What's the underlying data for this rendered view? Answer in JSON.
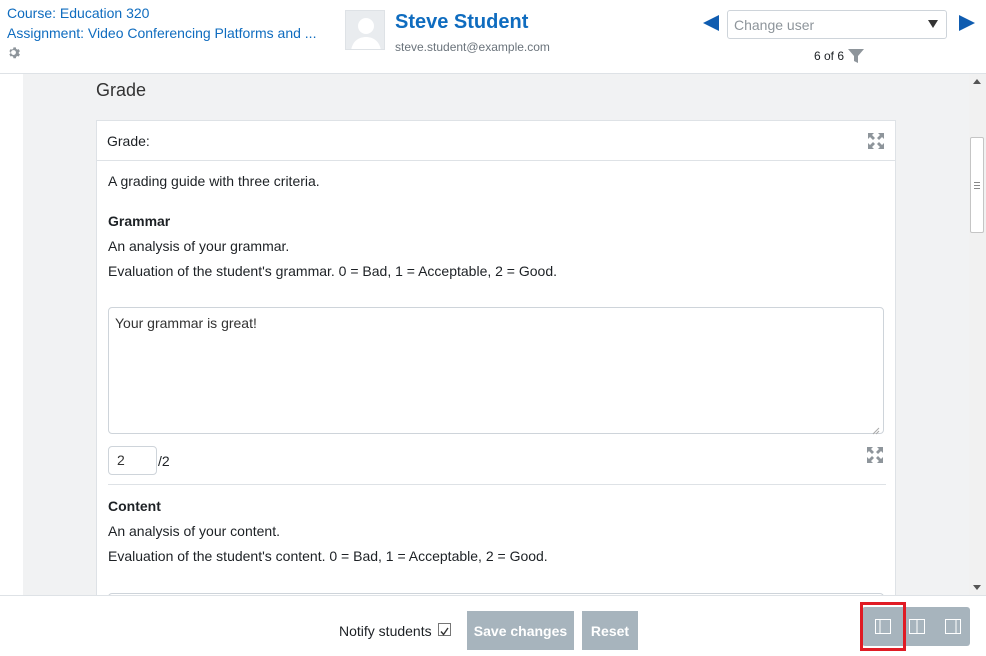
{
  "header": {
    "course": "Course: Education 320",
    "assignment": "Assignment: Video Conferencing Platforms and ...",
    "user_name": "Steve Student",
    "user_email": "steve.student@example.com",
    "change_user_placeholder": "Change user",
    "count": "6 of 6"
  },
  "panel": {
    "title": "Grade",
    "card_header": "Grade:",
    "guide_description": "A grading guide with three criteria.",
    "criteria": [
      {
        "name": "Grammar",
        "description": "An analysis of your grammar.",
        "evaluation": "Evaluation of the student's grammar. 0 = Bad, 1 = Acceptable, 2 = Good.",
        "remark": "Your grammar is great!",
        "score": "2",
        "max": "/2"
      },
      {
        "name": "Content",
        "description": "An analysis of your content.",
        "evaluation": "Evaluation of the student's content. 0 = Bad, 1 = Acceptable, 2 = Good."
      }
    ]
  },
  "footer": {
    "notify_label": "Notify students",
    "notify_checked": true,
    "save_label": "Save changes",
    "reset_label": "Reset"
  },
  "colors": {
    "link": "#0f6cbf",
    "button_bg": "#a7b4bd",
    "highlight": "#e01b24",
    "panel_bg": "#f1f2f3"
  },
  "icons": [
    "gear-icon",
    "avatar",
    "prev-user-icon",
    "next-user-icon",
    "filter-icon",
    "expand-icon",
    "layout-collapse-left-icon",
    "layout-default-icon",
    "layout-collapse-right-icon"
  ]
}
